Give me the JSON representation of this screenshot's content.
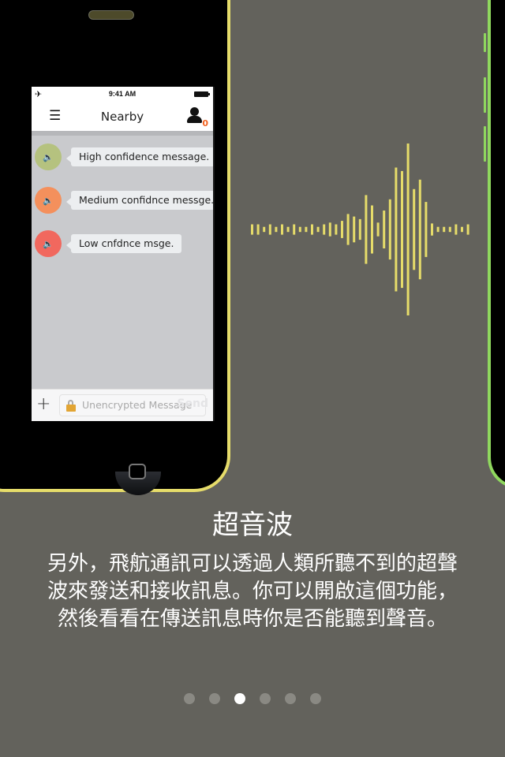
{
  "phone": {
    "status_bar": {
      "time": "9:41 AM",
      "airplane_icon": "airplane-icon",
      "battery_icon": "battery-icon"
    },
    "nav": {
      "menu_icon": "hamburger-icon",
      "title": "Nearby",
      "user_icon": "person-icon",
      "peer_count": "0"
    },
    "messages": [
      {
        "text": "High confidence message.",
        "icon": "speaker-icon",
        "confidence": "high",
        "color": "#b5c27f"
      },
      {
        "text": "Medium confidnce messge.",
        "icon": "speaker-icon",
        "confidence": "medium",
        "color": "#f4905c"
      },
      {
        "text": "Low cnfdnce msge.",
        "icon": "speaker-icon",
        "confidence": "low",
        "color": "#f1685e"
      }
    ],
    "input": {
      "add_icon": "plus-icon",
      "lock_icon": "unlocked-padlock-icon",
      "placeholder": "Unencrypted Message",
      "send_label": "Send"
    }
  },
  "waveform": {
    "color": "#e6dc6a",
    "amplitudes": [
      0.06,
      0.06,
      0.03,
      0.06,
      0.03,
      0.06,
      0.03,
      0.06,
      0.03,
      0.03,
      0.06,
      0.03,
      0.06,
      0.08,
      0.06,
      0.1,
      0.18,
      0.15,
      0.12,
      0.4,
      0.28,
      0.08,
      0.22,
      0.35,
      0.72,
      0.68,
      1.0,
      0.47,
      0.58,
      0.32,
      0.07,
      0.03,
      0.03,
      0.03,
      0.06,
      0.03,
      0.06
    ]
  },
  "caption": {
    "title": "超音波",
    "body_lines": [
      "另外，飛航通訊可以透過人類所聽不到的超聲",
      "波來發送和接收訊息。你可以開啟這個功能，",
      "然後看看在傳送訊息時你是否能聽到聲音。"
    ]
  },
  "pagination": {
    "total": 6,
    "current": 3
  }
}
